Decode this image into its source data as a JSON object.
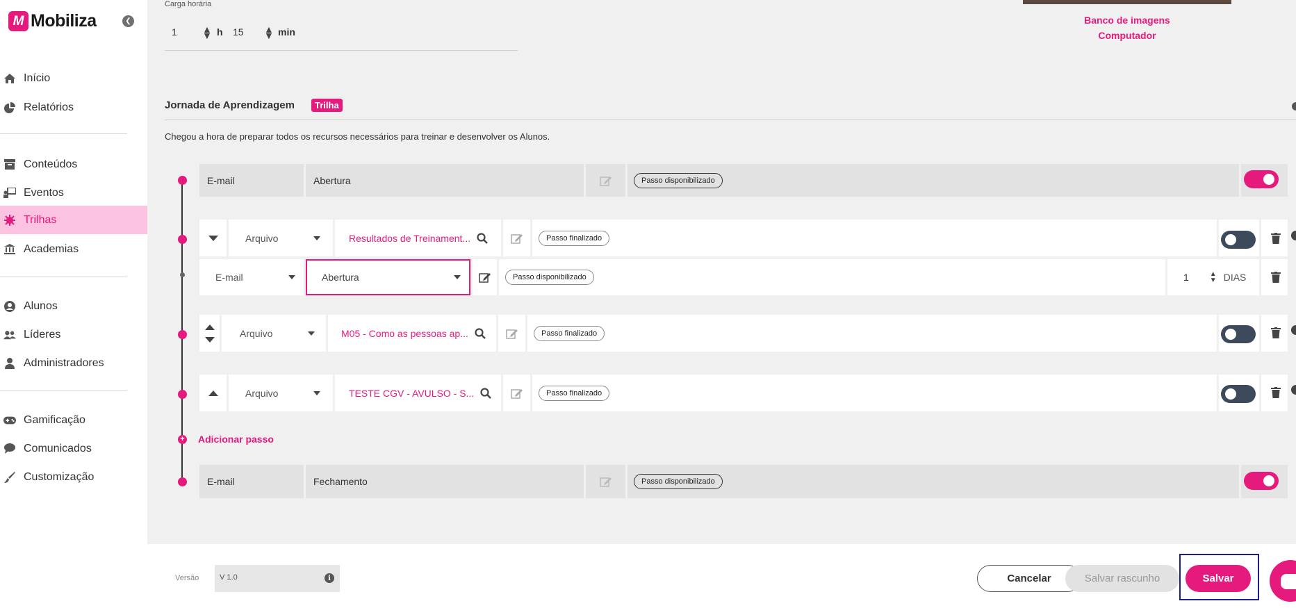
{
  "brand": {
    "name": "Mobiliza",
    "logo_letter": "M",
    "accent": "#e6197d"
  },
  "sidebar": {
    "items": [
      {
        "label": "Início",
        "icon": "home-icon"
      },
      {
        "label": "Relatórios",
        "icon": "pie-chart-icon"
      },
      {
        "label": "Conteúdos",
        "icon": "archive-icon"
      },
      {
        "label": "Eventos",
        "icon": "presentation-icon"
      },
      {
        "label": "Trilhas",
        "icon": "gear-burst-icon",
        "active": true
      },
      {
        "label": "Academias",
        "icon": "institution-icon"
      },
      {
        "label": "Alunos",
        "icon": "user-circle-icon"
      },
      {
        "label": "Líderes",
        "icon": "users-icon"
      },
      {
        "label": "Administradores",
        "icon": "user-tie-icon"
      },
      {
        "label": "Gamificação",
        "icon": "gamepad-icon"
      },
      {
        "label": "Comunicados",
        "icon": "speech-bubble-icon"
      },
      {
        "label": "Customização",
        "icon": "brush-icon"
      }
    ]
  },
  "carga": {
    "label": "Carga horária",
    "hours": "1",
    "h_unit": "h",
    "minutes": "15",
    "min_unit": "min"
  },
  "image_links": {
    "bank": "Banco de imagens",
    "computer": "Computador"
  },
  "journey": {
    "title": "Jornada de Aprendizagem",
    "badge": "Trilha",
    "description": "Chegou a hora de preparar todos os recursos necessários para treinar e desenvolver os Alunos."
  },
  "steps": {
    "opening": {
      "type": "E-mail",
      "name": "Abertura",
      "status": "Passo disponibilizado",
      "enabled": true
    },
    "step1": {
      "type": "Arquivo",
      "name": "Resultados de Treinament...",
      "status": "Passo finalizado",
      "enabled": false
    },
    "step1_sub": {
      "type": "E-mail",
      "name": "Abertura",
      "status": "Passo disponibilizado",
      "days_value": "1",
      "days_unit": "DIAS"
    },
    "step2": {
      "type": "Arquivo",
      "name": "M05 - Como as pessoas ap...",
      "status": "Passo finalizado",
      "enabled": false
    },
    "step3": {
      "type": "Arquivo",
      "name": "TESTE CGV - AVULSO - S...",
      "status": "Passo finalizado",
      "enabled": false
    },
    "add_step": "Adicionar passo",
    "closing": {
      "type": "E-mail",
      "name": "Fechamento",
      "status": "Passo disponibilizado",
      "enabled": true
    }
  },
  "footer": {
    "version_label": "Versão",
    "version_value": "V 1.0",
    "cancel": "Cancelar",
    "save_draft": "Salvar rascunho",
    "save": "Salvar"
  }
}
